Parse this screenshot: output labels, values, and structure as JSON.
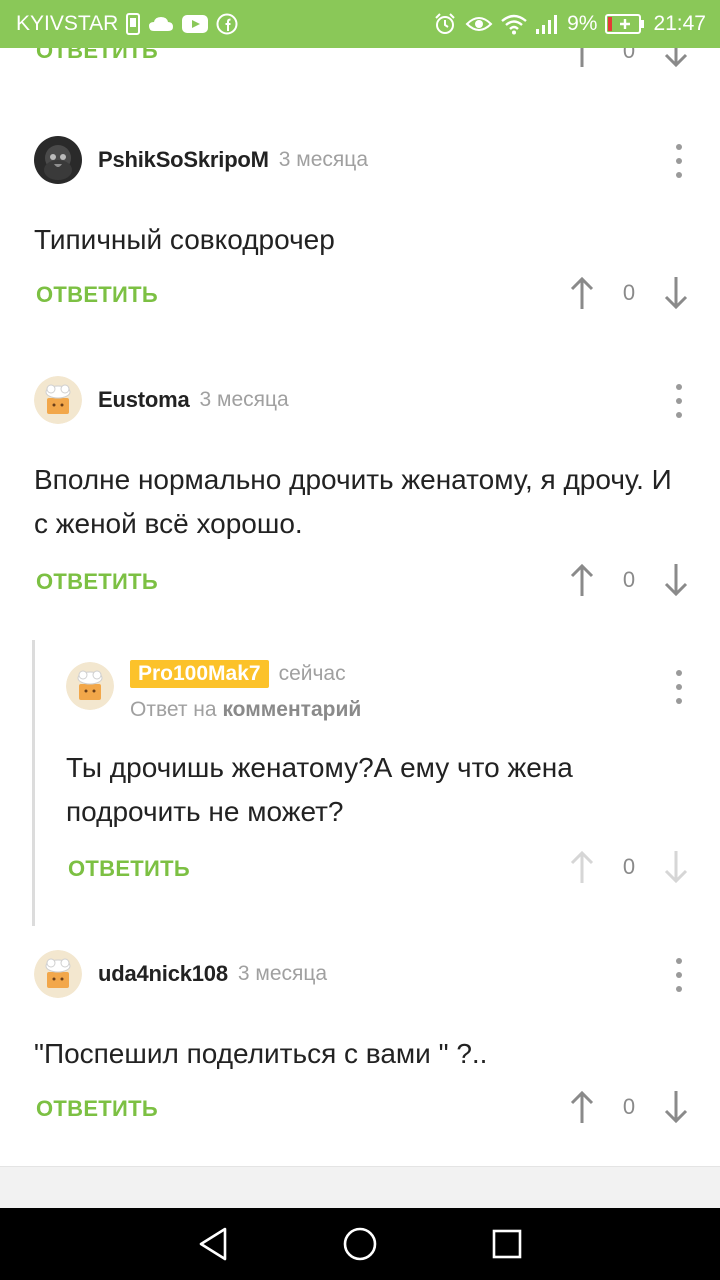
{
  "status_bar": {
    "carrier": "KYIVSTAR",
    "battery_percent": "9%",
    "time": "21:47",
    "icons": [
      "sim-icon",
      "cloud-icon",
      "youtube-icon",
      "facebook-icon",
      "alarm-icon",
      "eye-icon",
      "wifi-icon",
      "signal-icon",
      "battery-icon"
    ]
  },
  "top_partial": {
    "reply_label": "ОТВЕТИТЬ",
    "vote_count": "0"
  },
  "comments": [
    {
      "author": "PshikSoSkripoM",
      "time": "3 месяца",
      "text": "Типичный совкодрочер",
      "reply_label": "ОТВЕТИТЬ",
      "vote_count": "0"
    },
    {
      "author": "Eustoma",
      "time": "3 месяца",
      "text": "Вполне нормально дрочить женатому, я дрочу. И с женой всё хорошо.",
      "reply_label": "ОТВЕТИТЬ",
      "vote_count": "0"
    },
    {
      "author": "Pro100Mak7",
      "time": "сейчас",
      "reply_to_prefix": "Ответ на",
      "reply_to_target": "комментарий",
      "text": "Ты дрочишь женатому?А ему что жена подрочить не может?",
      "reply_label": "ОТВЕТИТЬ",
      "vote_count": "0"
    },
    {
      "author": "uda4nick108",
      "time": "3 месяца",
      "text": "\"Поспешил поделиться с вами \" ?..",
      "reply_label": "ОТВЕТИТЬ",
      "vote_count": "0"
    }
  ],
  "colors": {
    "status_bar": "#8ac858",
    "accent_green": "#7cc043",
    "badge_yellow": "#fcc22a",
    "text_dark": "#222222",
    "text_muted": "#a0a0a0"
  },
  "nav": {
    "icons": [
      "back-icon",
      "home-icon",
      "recents-icon"
    ]
  }
}
